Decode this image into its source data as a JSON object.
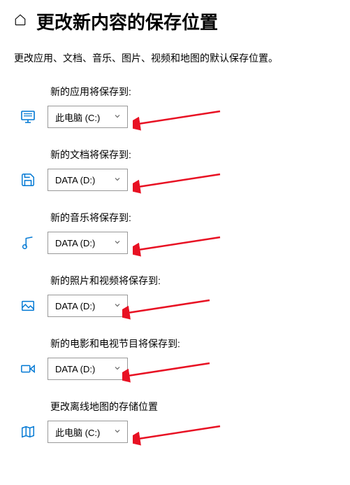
{
  "header": {
    "title": "更改新内容的保存位置"
  },
  "description": "更改应用、文档、音乐、图片、视频和地图的默认保存位置。",
  "items": [
    {
      "label": "新的应用将保存到:",
      "value": "此电脑 (C:)",
      "icon": "monitor"
    },
    {
      "label": "新的文档将保存到:",
      "value": "DATA (D:)",
      "icon": "save"
    },
    {
      "label": "新的音乐将保存到:",
      "value": "DATA (D:)",
      "icon": "music"
    },
    {
      "label": "新的照片和视频将保存到:",
      "value": "DATA (D:)",
      "icon": "image"
    },
    {
      "label": "新的电影和电视节目将保存到:",
      "value": "DATA (D:)",
      "icon": "video"
    },
    {
      "label": "更改离线地图的存储位置",
      "value": "此电脑 (C:)",
      "icon": "map"
    }
  ]
}
